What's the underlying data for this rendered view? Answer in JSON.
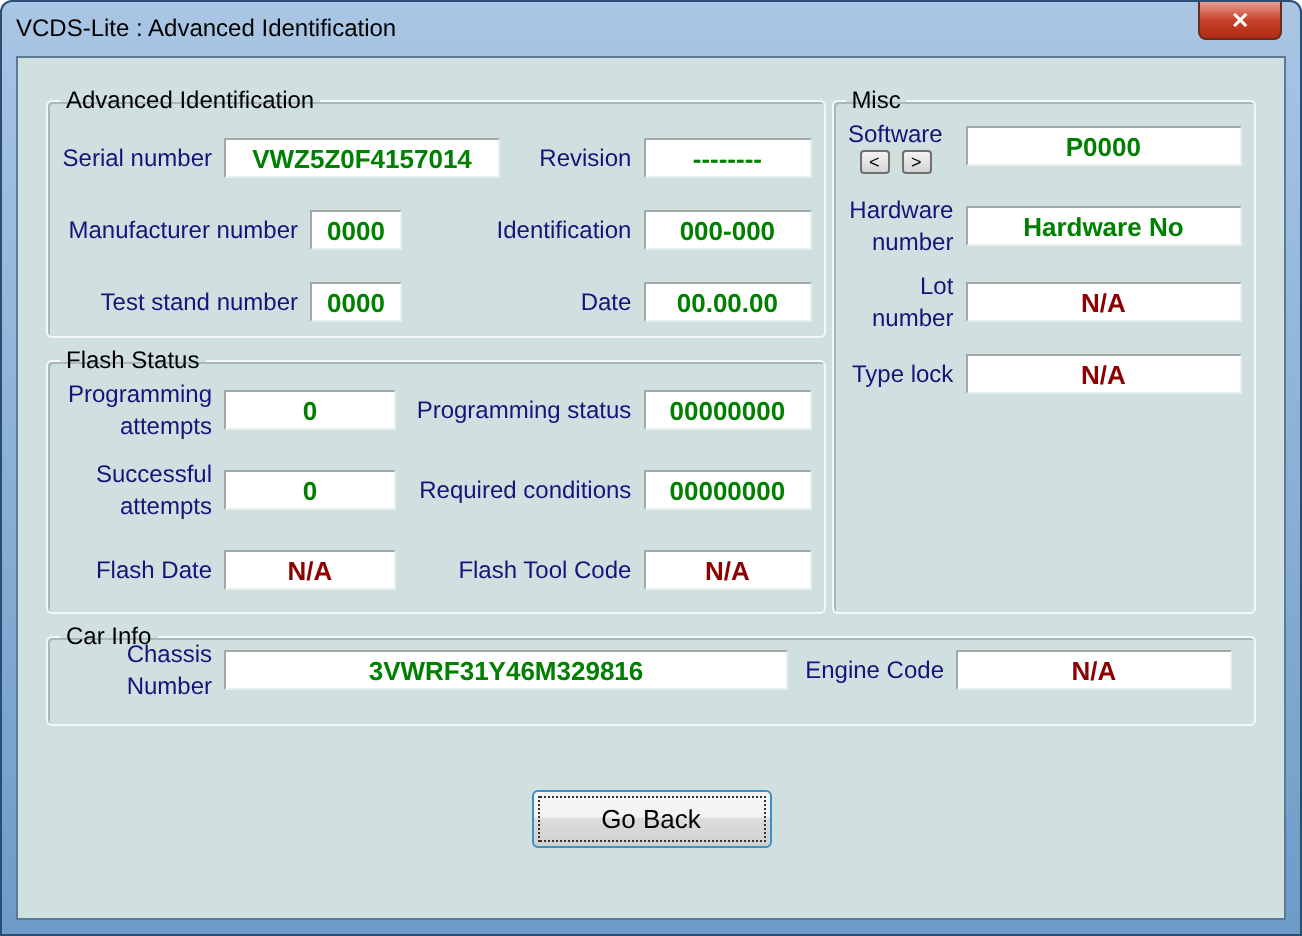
{
  "window": {
    "title": "VCDS-Lite : Advanced Identification",
    "close": "✕"
  },
  "advanced_identification": {
    "title": "Advanced Identification",
    "fields": [
      {
        "label": "Serial number",
        "value": "VWZ5Z0F4157014",
        "color": "#008000"
      },
      {
        "label": "Revision",
        "value": "--------",
        "color": "#008000"
      },
      {
        "label": "Manufacturer number",
        "value": "0000",
        "color": "#008000"
      },
      {
        "label": "Identification",
        "value": "000-000",
        "color": "#008000"
      },
      {
        "label": "Test stand number",
        "value": "0000",
        "color": "#008000"
      },
      {
        "label": "Date",
        "value": "00.00.00",
        "color": "#008000"
      }
    ]
  },
  "flash_status": {
    "title": "Flash Status",
    "fields": [
      {
        "label": "Programming attempts",
        "value": "0",
        "color": "#008000"
      },
      {
        "label": "Programming status",
        "value": "00000000",
        "color": "#008000"
      },
      {
        "label": "Successful attempts",
        "value": "0",
        "color": "#008000"
      },
      {
        "label": "Required conditions",
        "value": "00000000",
        "color": "#008000"
      },
      {
        "label": "Flash Date",
        "value": "N/A",
        "color": "#8b0000"
      },
      {
        "label": "Flash Tool Code",
        "value": "N/A",
        "color": "#8b0000"
      }
    ]
  },
  "misc": {
    "title": "Misc",
    "fields": [
      {
        "label": "Software",
        "value": "P0000",
        "color": "#008000",
        "nav": [
          "<",
          ">"
        ]
      },
      {
        "label": "Hardware number",
        "value": "Hardware No",
        "color": "#008000"
      },
      {
        "label": "Lot number",
        "value": "N/A",
        "color": "#8b0000"
      },
      {
        "label": "Type lock",
        "value": "N/A",
        "color": "#8b0000"
      }
    ]
  },
  "car_info": {
    "title": "Car Info",
    "fields": [
      {
        "label": "Chassis Number",
        "value": "3VWRF31Y46M329816",
        "color": "#008000"
      },
      {
        "label": "Engine Code",
        "value": "N/A",
        "color": "#8b0000"
      }
    ]
  },
  "buttons": [
    "Go Back"
  ]
}
